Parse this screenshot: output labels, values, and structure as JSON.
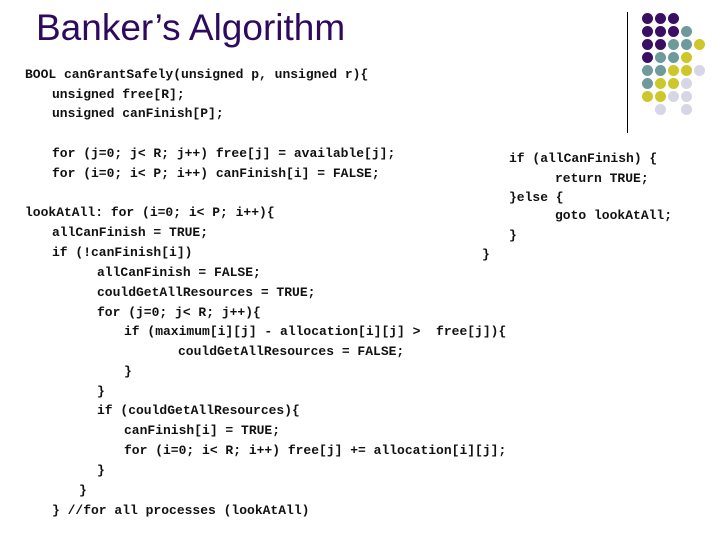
{
  "slide": {
    "title": "Banker’s Algorithm",
    "colors": {
      "title": "#2e0a5e",
      "purple": "#3a0f63",
      "teal": "#6f9a9c",
      "yellow": "#cdc72a",
      "lavender": "#d6d6e6"
    },
    "decoration": {
      "dot_grid": [
        [
          "purple",
          "purple",
          "purple",
          null,
          null
        ],
        [
          "purple",
          "purple",
          "purple",
          "teal",
          null
        ],
        [
          "purple",
          "purple",
          "teal",
          "teal",
          "yellow"
        ],
        [
          "purple",
          "teal",
          "teal",
          "yellow",
          null
        ],
        [
          "teal",
          "teal",
          "yellow",
          "yellow",
          "lavender"
        ],
        [
          "teal",
          "yellow",
          "yellow",
          "lavender",
          null
        ],
        [
          "yellow",
          "yellow",
          "lavender",
          "lavender",
          null
        ],
        [
          null,
          "lavender",
          null,
          "lavender",
          null
        ]
      ]
    },
    "code_left": [
      {
        "text": "BOOL canGrantSafely(unsigned p, unsigned r){",
        "indent": 0
      },
      {
        "text": "unsigned free[R];",
        "indent": 1
      },
      {
        "text": "unsigned canFinish[P];",
        "indent": 1
      },
      {
        "text": "",
        "indent": 0
      },
      {
        "text": "for (j=0; j< R; j++) free[j] = available[j];",
        "indent": 1
      },
      {
        "text": "for (i=0; i< P; i++) canFinish[i] = FALSE;",
        "indent": 1
      },
      {
        "text": "",
        "indent": 0
      },
      {
        "text": "lookAtAll: for (i=0; i< P; i++){",
        "indent": 0
      },
      {
        "text": "allCanFinish = TRUE;",
        "indent": 1
      },
      {
        "text": "if (!canFinish[i])",
        "indent": 1
      },
      {
        "text": "allCanFinish = FALSE;",
        "indent": 2
      },
      {
        "text": "couldGetAllResources = TRUE;",
        "indent": 2
      },
      {
        "text": "for (j=0; j< R; j++){",
        "indent": 2
      },
      {
        "text": "if (maximum[i][j] - allocation[i][j] >  free[j]){",
        "indent": 3
      },
      {
        "text": "couldGetAllResources = FALSE;",
        "indent": 4
      },
      {
        "text": "}",
        "indent": 3
      },
      {
        "text": "}",
        "indent": 2
      },
      {
        "text": "if (couldGetAllResources){",
        "indent": 2
      },
      {
        "text": "canFinish[i] = TRUE;",
        "indent": 3
      },
      {
        "text": "for (i=0; i< R; i++) free[j] += allocation[i][j];",
        "indent": 3
      },
      {
        "text": "}",
        "indent": 2
      },
      {
        "text": "}",
        "indent": 1
      },
      {
        "text": "} //for all processes (lookAtAll)",
        "indent": 1
      }
    ],
    "code_right": [
      {
        "text": "if (allCanFinish) {"
      },
      {
        "text": "return TRUE;"
      },
      {
        "text": "}else {"
      },
      {
        "text": "goto lookAtAll;"
      },
      {
        "text": "}"
      },
      {
        "text": "}"
      }
    ]
  }
}
